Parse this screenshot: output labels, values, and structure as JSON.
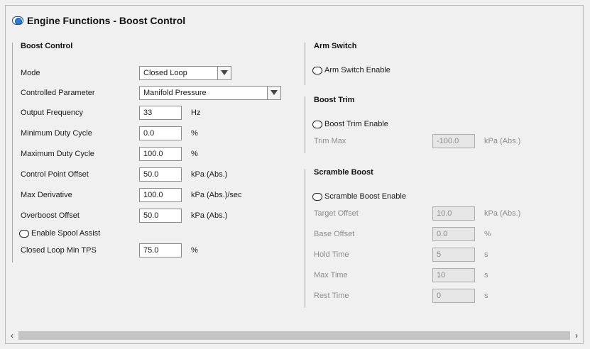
{
  "header": {
    "title": "Engine Functions - Boost Control"
  },
  "boost_control": {
    "title": "Boost Control",
    "mode": {
      "label": "Mode",
      "value": "Closed Loop"
    },
    "controlled_parameter": {
      "label": "Controlled Parameter",
      "value": "Manifold Pressure"
    },
    "rows": [
      {
        "label": "Output Frequency",
        "value": "33",
        "unit": "Hz"
      },
      {
        "label": "Minimum Duty Cycle",
        "value": "0.0",
        "unit": "%"
      },
      {
        "label": "Maximum Duty Cycle",
        "value": "100.0",
        "unit": "%"
      },
      {
        "label": "Control Point Offset",
        "value": "50.0",
        "unit": "kPa (Abs.)"
      },
      {
        "label": "Max Derivative",
        "value": "100.0",
        "unit": "kPa (Abs.)/sec"
      },
      {
        "label": "Overboost Offset",
        "value": "50.0",
        "unit": "kPa (Abs.)"
      }
    ],
    "spool_assist": {
      "label": "Enable Spool Assist"
    },
    "min_tps": {
      "label": "Closed Loop Min TPS",
      "value": "75.0",
      "unit": "%"
    }
  },
  "arm_switch": {
    "title": "Arm Switch",
    "enable_label": "Arm Switch Enable"
  },
  "boost_trim": {
    "title": "Boost Trim",
    "enable_label": "Boost Trim Enable",
    "trim_max": {
      "label": "Trim Max",
      "value": "-100.0",
      "unit": "kPa (Abs.)"
    }
  },
  "scramble_boost": {
    "title": "Scramble Boost",
    "enable_label": "Scramble Boost Enable",
    "rows": [
      {
        "label": "Target Offset",
        "value": "10.0",
        "unit": "kPa (Abs.)"
      },
      {
        "label": "Base Offset",
        "value": "0.0",
        "unit": "%"
      },
      {
        "label": "Hold Time",
        "value": "5",
        "unit": "s"
      },
      {
        "label": "Max Time",
        "value": "10",
        "unit": "s"
      },
      {
        "label": "Rest Time",
        "value": "0",
        "unit": "s"
      }
    ]
  },
  "scrollbar": {
    "left_arrow": "‹",
    "right_arrow": "›"
  }
}
